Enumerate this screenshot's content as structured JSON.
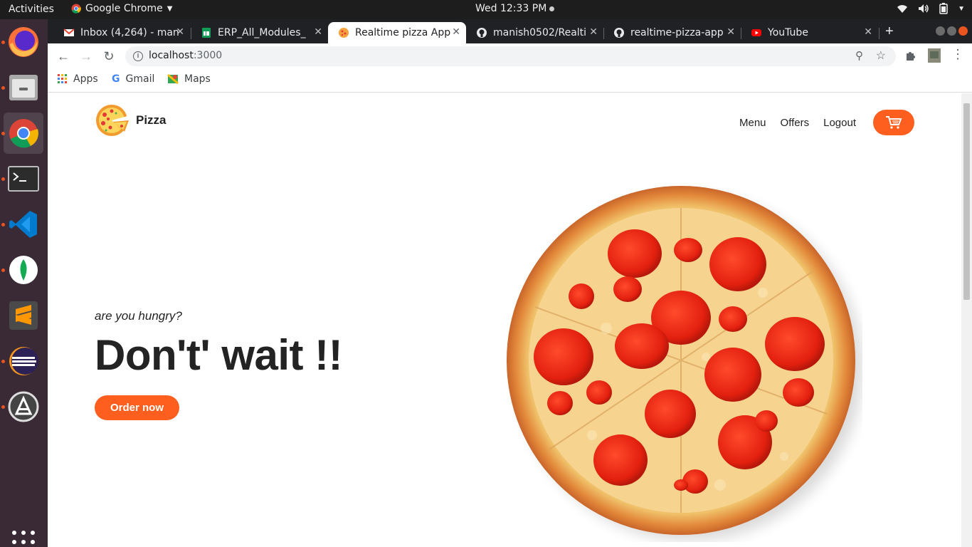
{
  "system_bar": {
    "activities": "Activities",
    "app_name": "Google Chrome",
    "clock": "Wed 12:33 PM"
  },
  "dock": {
    "items": [
      "firefox-icon",
      "files-icon",
      "chrome-icon",
      "terminal-icon",
      "vscode-icon",
      "mongodb-compass-icon",
      "sublime-text-icon",
      "eclipse-icon",
      "software-updater-icon",
      "show-apps-icon"
    ]
  },
  "browser": {
    "tabs": [
      {
        "title": "Inbox (4,264) - man",
        "favicon": "gmail-icon"
      },
      {
        "title": "ERP_All_Modules_",
        "favicon": "sheets-icon"
      },
      {
        "title": "Realtime pizza App",
        "favicon": "pizza-icon",
        "active": true
      },
      {
        "title": "manish0502/Realti",
        "favicon": "github-icon"
      },
      {
        "title": "realtime-pizza-app",
        "favicon": "github-icon"
      },
      {
        "title": "YouTube",
        "favicon": "youtube-icon"
      }
    ],
    "url_host": "localhost",
    "url_port": ":3000",
    "bookmarks": [
      "Apps",
      "Gmail",
      "Maps"
    ]
  },
  "page": {
    "brand": "Pizza",
    "nav": {
      "menu": "Menu",
      "offers": "Offers",
      "logout": "Logout"
    },
    "hero": {
      "tagline": "are you hungry?",
      "headline": "Don't' wait !!",
      "cta": "Order now"
    },
    "colors": {
      "accent": "#fe5f1e",
      "text": "#232323"
    }
  }
}
